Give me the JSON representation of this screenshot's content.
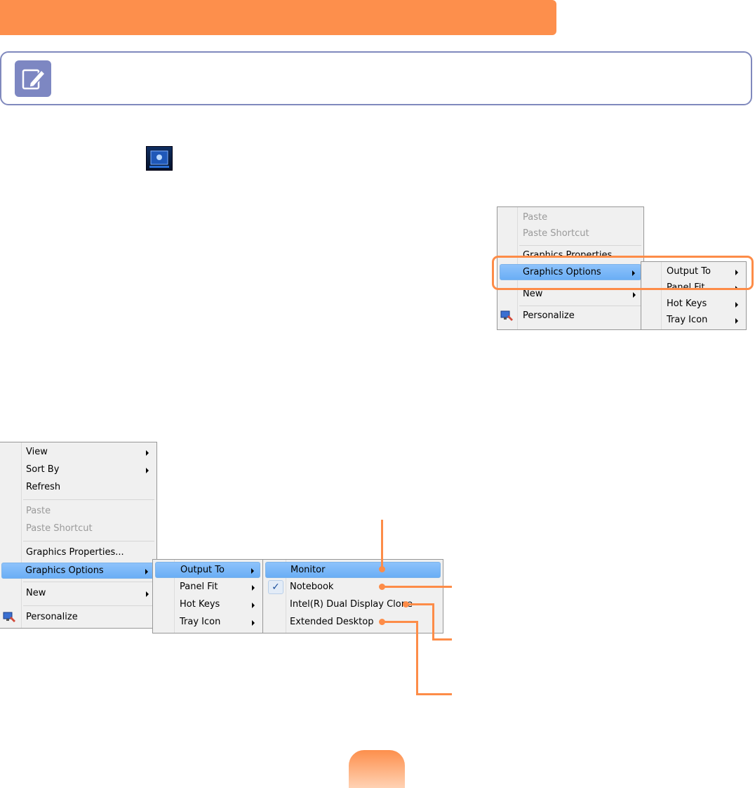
{
  "colors": {
    "header_orange": "#fd8f4c",
    "note_border": "#8089bd",
    "menu_highlight": "#7ab8f8",
    "callout_orange": "#fd8c48"
  },
  "icons": {
    "note": "pencil-note-icon",
    "tray": "graphics-tray-icon",
    "personalize": "personalize-icon",
    "checkmark": "checkmark-icon"
  },
  "small_menu": {
    "main": [
      {
        "label": "Paste",
        "disabled": true
      },
      {
        "label": "Paste Shortcut",
        "disabled": true
      },
      {
        "label": "Graphics Properties...",
        "disabled": false
      },
      {
        "label": "Graphics Options",
        "highlighted": true
      },
      {
        "label": "New",
        "disabled": false
      },
      {
        "label": "Personalize",
        "disabled": false
      }
    ],
    "submenu": [
      "Output To",
      "Panel Fit",
      "Hot Keys",
      "Tray Icon"
    ]
  },
  "large_menu": {
    "main": [
      {
        "label": "View"
      },
      {
        "label": "Sort By"
      },
      {
        "label": "Refresh"
      },
      {
        "label": "Paste",
        "disabled": true
      },
      {
        "label": "Paste Shortcut",
        "disabled": true
      },
      {
        "label": "Graphics Properties..."
      },
      {
        "label": "Graphics Options",
        "highlighted": true
      },
      {
        "label": "New"
      },
      {
        "label": "Personalize"
      }
    ],
    "submenu": [
      "Output To",
      "Panel Fit",
      "Hot Keys",
      "Tray Icon"
    ],
    "output_menu": [
      {
        "label": "Monitor",
        "highlighted": true
      },
      {
        "label": "Notebook",
        "checked": true
      },
      {
        "label": "Intel(R) Dual Display Clone"
      },
      {
        "label": "Extended Desktop"
      }
    ]
  }
}
